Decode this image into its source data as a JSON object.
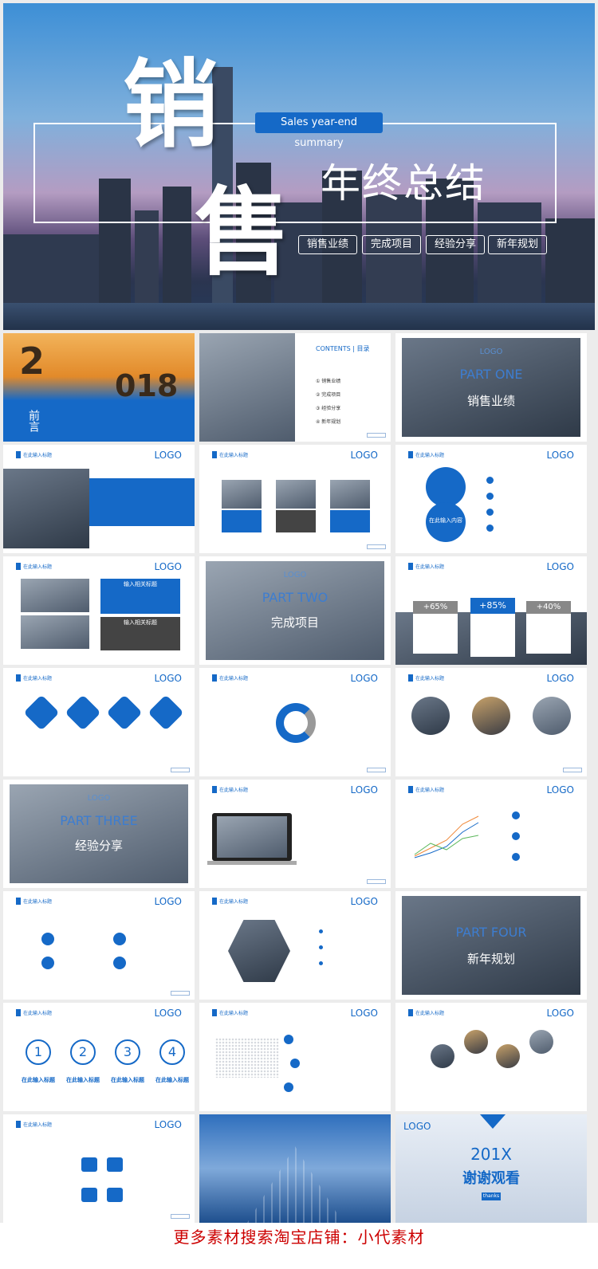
{
  "hero": {
    "char1": "销",
    "char2": "售",
    "subtitle": "Sales year-end summary",
    "title": "年终总结",
    "tags": [
      "销售业绩",
      "完成项目",
      "经验分享",
      "新年规划"
    ]
  },
  "slides": {
    "logo": "LOGO",
    "header_label": "在此输入标题",
    "preface": {
      "year_big": "2",
      "year_rest": "018",
      "label": "前言"
    },
    "contents": {
      "title": "CONTENTS",
      "title_cn": "目录",
      "items": [
        "销售业绩",
        "完成项目",
        "经验分享",
        "新年规划"
      ]
    },
    "part_one": {
      "part": "PART ONE",
      "title": "销售业绩"
    },
    "part_two": {
      "part": "PART TWO",
      "title": "完成项目"
    },
    "part_three": {
      "part": "PART THREE",
      "title": "经验分享"
    },
    "part_four": {
      "part": "PART FOUR",
      "title": "新年规划"
    },
    "input_content": "在此输入内容",
    "input_title_label": "输入相关标题",
    "percents": [
      "+65%",
      "+85%",
      "+40%"
    ],
    "numbers": [
      "1",
      "2",
      "3",
      "4"
    ],
    "num_titles": [
      "在此输入标题",
      "在此输入标题",
      "在此输入标题",
      "在此输入标题"
    ],
    "thanks": {
      "year": "201X",
      "text": "谢谢观看",
      "badge": "thanks"
    }
  },
  "footer": {
    "text": "更多素材搜索淘宝店铺：小代素材"
  },
  "colors": {
    "accent": "#1569c7",
    "footer": "#cc0000"
  }
}
